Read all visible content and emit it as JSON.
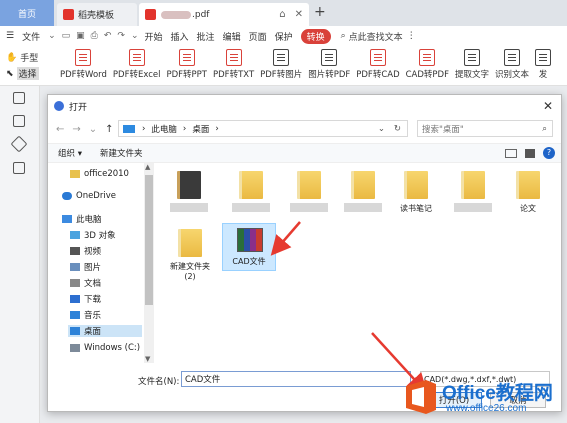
{
  "tabs": {
    "home": "首页",
    "template": "稻壳模板",
    "pdf_suffix": ".pdf"
  },
  "menu": {
    "file": "文件",
    "items": [
      "开始",
      "插入",
      "批注",
      "编辑",
      "页面",
      "保护"
    ],
    "convert": "转换",
    "search": "点此查找文本"
  },
  "ribbon": {
    "hand": "手型",
    "select": "选择",
    "buttons": [
      "PDF转Word",
      "PDF转Excel",
      "PDF转PPT",
      "PDF转TXT",
      "PDF转图片",
      "图片转PDF",
      "PDF转CAD",
      "CAD转PDF",
      "提取文字",
      "识别文本",
      "发"
    ]
  },
  "dialog": {
    "title": "打开",
    "address": [
      "此电脑",
      "桌面"
    ],
    "search_placeholder": "搜索\"桌面\"",
    "organize": "组织 ▾",
    "new_folder": "新建文件夹",
    "help": "?",
    "nav": [
      "office2010",
      "OneDrive",
      "此电脑",
      "3D 对象",
      "视频",
      "图片",
      "文档",
      "下载",
      "音乐",
      "桌面",
      "Windows (C:)"
    ],
    "files": {
      "reader_notes": "读书笔记",
      "essay": "论文",
      "new_folder_2": "新建文件夹\n(2)",
      "cad_file": "CAD文件"
    },
    "filename_label": "文件名(N):",
    "filename_value": "CAD文件",
    "filter": "CAD(*.dwg,*.dxf,*.dwt)",
    "open": "打开(O)",
    "cancel": "取消"
  },
  "watermark": {
    "brand": "Office教程网",
    "url": "www.office26.com"
  }
}
